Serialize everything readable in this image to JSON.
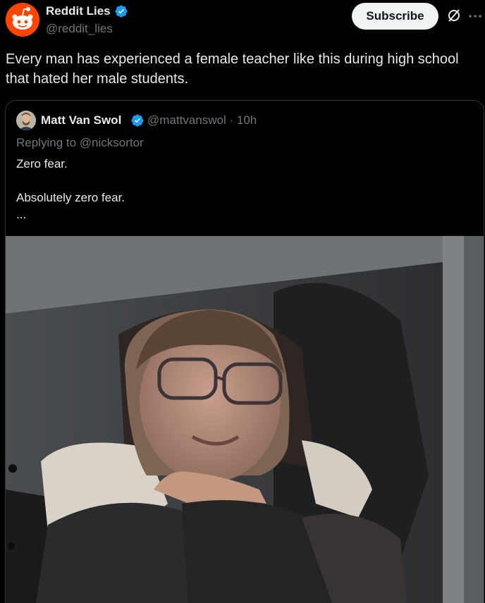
{
  "post": {
    "author_name": "Reddit Lies",
    "author_handle": "@reddit_lies",
    "subscribe_label": "Subscribe",
    "text": "Every man has experienced a female teacher like this during high school that hated her male students."
  },
  "quoted": {
    "author_name": "Matt Van Swol",
    "author_handle": "@mattvanswol",
    "separator": "·",
    "time": "10h",
    "replying_to": "Replying to @nicksortor",
    "lines": [
      "Zero fear.",
      "",
      "Absolutely zero fear.",
      "..."
    ]
  },
  "icons": {
    "verified": "verified-badge-icon",
    "grok": "grok-icon",
    "more": "more-options-icon"
  },
  "colors": {
    "background": "#000000",
    "text_primary": "#e7e9ea",
    "text_secondary": "#71767b",
    "verified_blue": "#1d9bf0",
    "reddit_orange": "#ff4500",
    "subscribe_bg": "#eff3f4",
    "border": "#2f3336"
  }
}
